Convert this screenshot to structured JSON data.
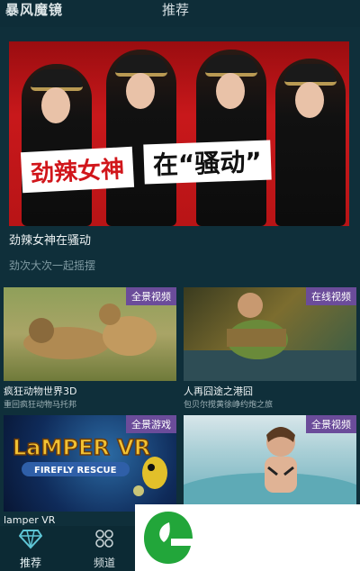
{
  "header": {
    "app_title": "暴风魔镜",
    "tab_title": "推荐"
  },
  "banner": {
    "text_left": "劲辣女神",
    "text_right": "在“骚动”",
    "caption": "劲辣女神在骚动",
    "subtitle": "劲次大次一起摇摆",
    "page_count": 3,
    "active_page": 1
  },
  "cards": [
    {
      "badge": "全景视频",
      "title": "疯狂动物世界3D",
      "subtitle": "重回疯狂动物马托邦"
    },
    {
      "badge": "在线视频",
      "title": "人再囧途之港囧",
      "subtitle": "包贝尔搅黄徐峥约炮之旅"
    },
    {
      "badge": "全景游戏",
      "title": "lamper VR",
      "subtitle": "",
      "art_text_1": "LaMPER VR",
      "art_text_2": "FIREFLY RESCUE"
    },
    {
      "badge": "全景视频",
      "title": "",
      "subtitle": ""
    }
  ],
  "nav": {
    "items": [
      {
        "label": "推荐",
        "icon": "diamond-icon",
        "active": true
      },
      {
        "label": "频道",
        "icon": "grid-icon",
        "active": false
      }
    ]
  },
  "colors": {
    "background": "#0f2f3a",
    "badge": "#6b4c9a",
    "banner_red": "#c8181b",
    "logo_green": "#22a63a"
  }
}
